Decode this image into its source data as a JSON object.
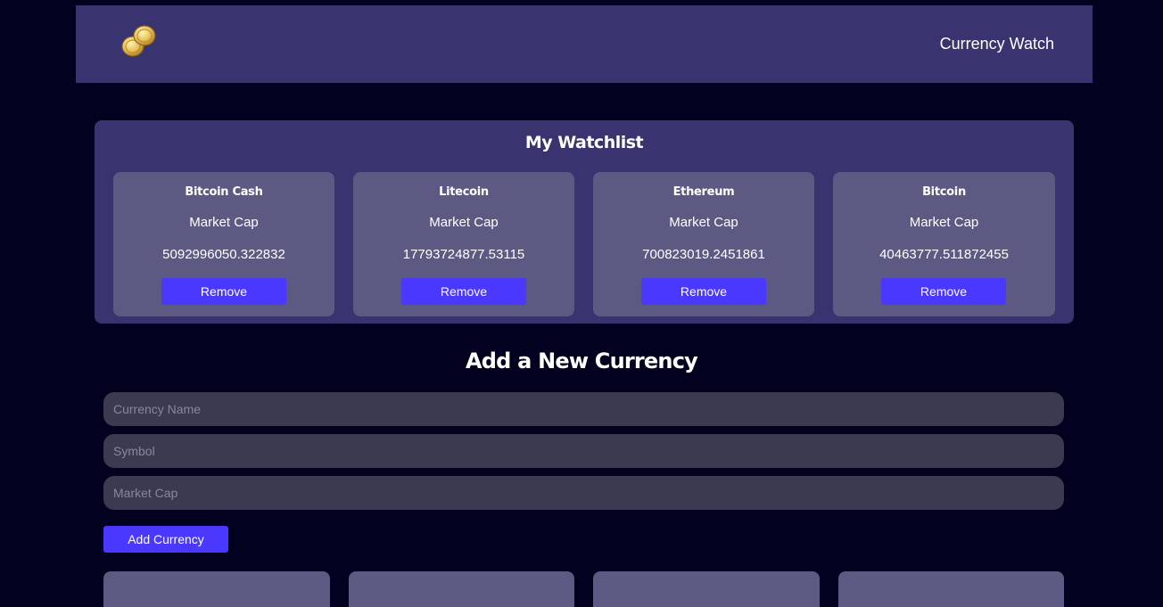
{
  "header": {
    "app_title": "Currency Watch",
    "logo_icon": "coins-icon"
  },
  "watchlist": {
    "title": "My Watchlist",
    "cards": [
      {
        "name": "Bitcoin Cash",
        "label": "Market Cap",
        "value": "5092996050.322832",
        "remove_label": "Remove"
      },
      {
        "name": "Litecoin",
        "label": "Market Cap",
        "value": "17793724877.53115",
        "remove_label": "Remove"
      },
      {
        "name": "Ethereum",
        "label": "Market Cap",
        "value": "700823019.2451861",
        "remove_label": "Remove"
      },
      {
        "name": "Bitcoin",
        "label": "Market Cap",
        "value": "40463777.511872455",
        "remove_label": "Remove"
      }
    ]
  },
  "add_form": {
    "title": "Add a New Currency",
    "name_placeholder": "Currency Name",
    "symbol_placeholder": "Symbol",
    "market_cap_placeholder": "Market Cap",
    "submit_label": "Add Currency"
  },
  "colors": {
    "background": "#020220",
    "panel": "#39346f",
    "card": "#5c5983",
    "accent": "#4a38ff",
    "input": "#3c3a51"
  }
}
